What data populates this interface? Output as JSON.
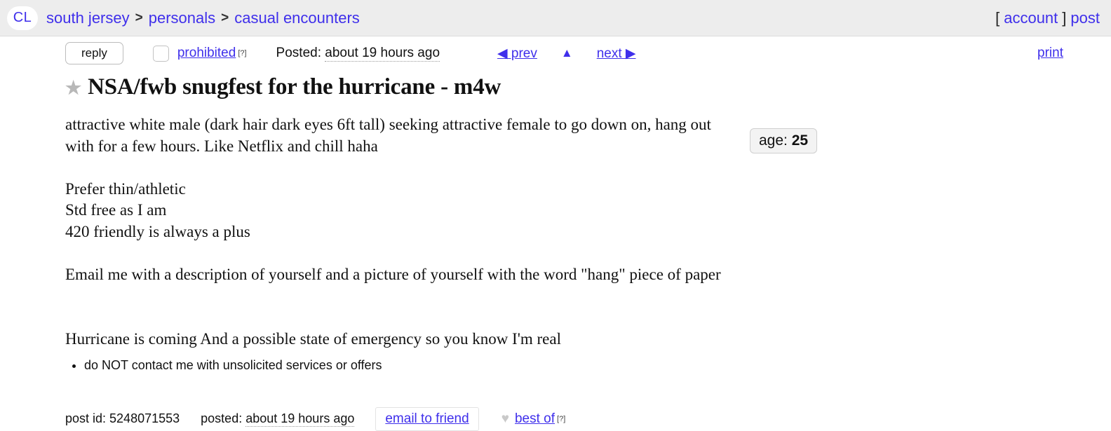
{
  "header": {
    "logo_text": "CL",
    "breadcrumb": [
      {
        "label": "south jersey"
      },
      {
        "label": "personals"
      },
      {
        "label": "casual encounters"
      }
    ],
    "separator": ">",
    "bracket_open": "[",
    "bracket_close": "]",
    "account_label": "account",
    "post_label": "post"
  },
  "toolbar": {
    "reply_label": "reply",
    "prohibited_label": "prohibited",
    "help_superscript": "[?]",
    "posted_prefix": "Posted:",
    "posted_time": "about 19 hours ago",
    "prev_label": "◀ prev",
    "up_label": "▲",
    "next_label": "next ▶",
    "print_label": "print"
  },
  "posting": {
    "star_glyph": "★",
    "title": "NSA/fwb snugfest for the hurricane - m4w",
    "body": "attractive white male (dark hair dark eyes 6ft tall) seeking attractive female to go down on, hang out with for a few hours. Like Netflix and chill haha\n\nPrefer thin/athletic\nStd free as I am\n420 friendly is always a plus\n\nEmail me with a description of yourself and a picture of yourself with the word \"hang\" piece of paper\n\n\nHurricane is coming And a possible state of emergency so you know I'm real",
    "attributes": [
      {
        "key": "age:",
        "value": "25"
      }
    ],
    "notices": [
      "do NOT contact me with unsolicited services or offers"
    ]
  },
  "footer": {
    "post_id_label": "post id: 5248071553",
    "posted_label": "posted:",
    "posted_time": "about 19 hours ago",
    "email_to_friend_label": "email to friend",
    "heart_glyph": "♥",
    "best_of_label": "best of",
    "help_superscript": "[?]"
  },
  "colors": {
    "link": "#3f2feb",
    "header_bg": "#ededed",
    "chip_bg": "#f3f3f3",
    "star_gray": "#b8b8b8"
  }
}
